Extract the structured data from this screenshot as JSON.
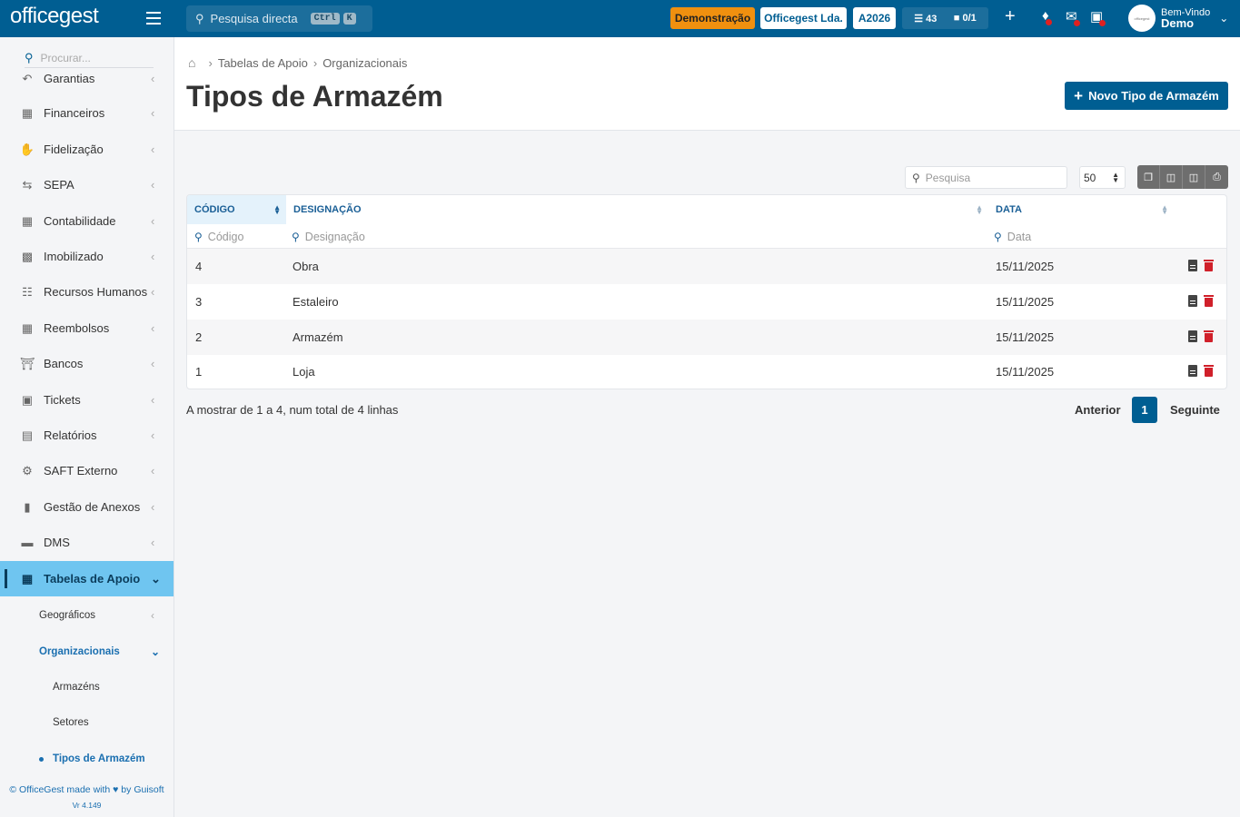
{
  "topbar": {
    "logo": "officegest",
    "search_placeholder": "Pesquisa directa",
    "shortcut_key1": "Ctrl",
    "shortcut_key2": "K",
    "demo_label": "Demonstração",
    "company_label": "Officegest Lda.",
    "year_label": "A2026",
    "tasks_count": "43",
    "docs_count": "0/1",
    "user_welcome": "Bem-Vindo",
    "user_name": "Demo",
    "avatar_text": "officegest"
  },
  "sidebar": {
    "search_placeholder": "Procurar...",
    "items": [
      {
        "label": "Garantias",
        "icon": "undo-icon"
      },
      {
        "label": "Financeiros",
        "icon": "money-icon"
      },
      {
        "label": "Fidelização",
        "icon": "hand-coin-icon"
      },
      {
        "label": "SEPA",
        "icon": "exchange-icon"
      },
      {
        "label": "Contabilidade",
        "icon": "calculator-icon"
      },
      {
        "label": "Imobilizado",
        "icon": "box-icon"
      },
      {
        "label": "Recursos Humanos",
        "icon": "org-chart-icon"
      },
      {
        "label": "Reembolsos",
        "icon": "money-icon"
      },
      {
        "label": "Bancos",
        "icon": "bank-icon"
      },
      {
        "label": "Tickets",
        "icon": "ticket-icon"
      },
      {
        "label": "Relatórios",
        "icon": "chart-icon"
      },
      {
        "label": "SAFT Externo",
        "icon": "saft-icon"
      },
      {
        "label": "Gestão de Anexos",
        "icon": "file-icon"
      },
      {
        "label": "DMS",
        "icon": "folder-icon"
      },
      {
        "label": "Tabelas de Apoio",
        "icon": "table-icon"
      }
    ],
    "sub_items": {
      "geo": "Geográficos",
      "org": "Organizacionais",
      "armazens": "Armazéns",
      "setores": "Setores",
      "tipos": "Tipos de Armazém"
    },
    "footer_text": "© OfficeGest made with ♥ by Guisoft",
    "version": "Vr 4.149"
  },
  "header": {
    "breadcrumb": [
      "Tabelas de Apoio",
      "Organizacionais"
    ],
    "title": "Tipos de Armazém",
    "new_button": "Novo Tipo de Armazém"
  },
  "table": {
    "search_placeholder": "Pesquisa",
    "page_size": "50",
    "columns": [
      "Código",
      "Designação",
      "Data"
    ],
    "filters": [
      "Código",
      "Designação",
      "Data"
    ],
    "rows": [
      {
        "codigo": "4",
        "designacao": "Obra",
        "data": "15/11/2025"
      },
      {
        "codigo": "3",
        "designacao": "Estaleiro",
        "data": "15/11/2025"
      },
      {
        "codigo": "2",
        "designacao": "Armazém",
        "data": "15/11/2025"
      },
      {
        "codigo": "1",
        "designacao": "Loja",
        "data": "15/11/2025"
      }
    ],
    "info": "A mostrar de 1 a 4, num total de 4 linhas",
    "prev": "Anterior",
    "page": "1",
    "next": "Seguinte"
  },
  "colors": {
    "primary": "#005e92",
    "active_menu": "#6fc5f0",
    "demo_badge": "#f0900f",
    "delete": "#d0202a"
  }
}
